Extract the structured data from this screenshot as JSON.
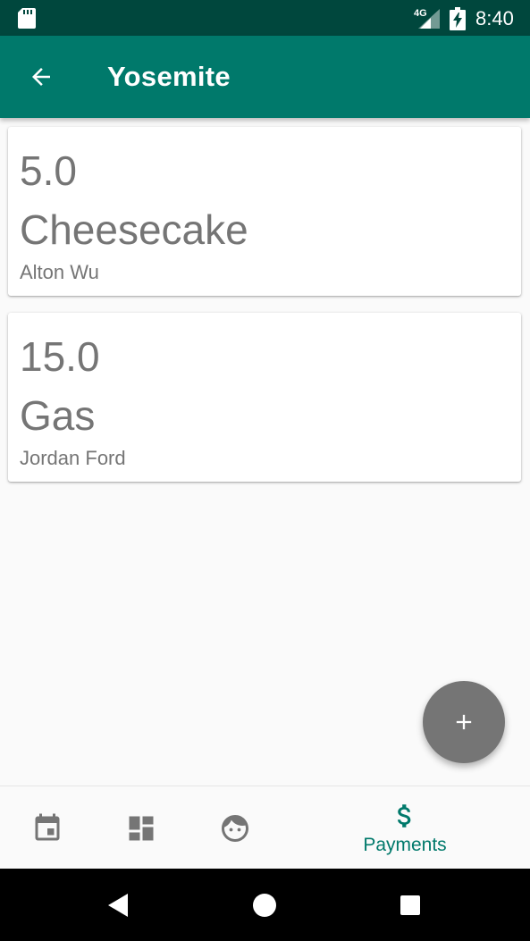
{
  "status_bar": {
    "network": "4G",
    "time": "8:40"
  },
  "app_bar": {
    "title": "Yosemite"
  },
  "payments": [
    {
      "amount": "5.0",
      "description": "Cheesecake",
      "payer": "Alton Wu"
    },
    {
      "amount": "15.0",
      "description": "Gas",
      "payer": "Jordan Ford"
    }
  ],
  "bottom_nav": {
    "items": [
      {
        "icon": "calendar-icon",
        "label": ""
      },
      {
        "icon": "dashboard-icon",
        "label": ""
      },
      {
        "icon": "face-icon",
        "label": ""
      },
      {
        "icon": "dollar-icon",
        "label": "Payments",
        "active": true
      }
    ]
  },
  "colors": {
    "status_bar": "#00473d",
    "primary": "#00796b",
    "fab": "#757575",
    "card_text": "#757575",
    "background": "#fafafa"
  }
}
